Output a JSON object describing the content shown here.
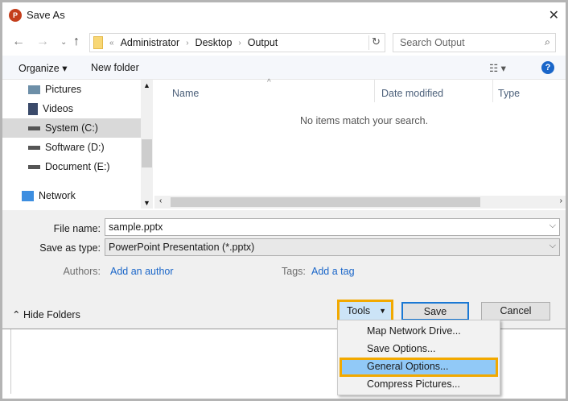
{
  "window": {
    "title": "Save As",
    "app_icon": "P"
  },
  "nav": {
    "path": [
      "Administrator",
      "Desktop",
      "Output"
    ],
    "overflow": "«",
    "search_placeholder": "Search Output"
  },
  "toolbar": {
    "organize": "Organize ▾",
    "new_folder": "New folder",
    "help": "?"
  },
  "sidebar": {
    "items": [
      {
        "label": "Pictures"
      },
      {
        "label": "Videos"
      },
      {
        "label": "System (C:)",
        "selected": true
      },
      {
        "label": "Software (D:)"
      },
      {
        "label": "Document (E:)"
      },
      {
        "label": "Network"
      }
    ]
  },
  "content": {
    "columns": [
      "Name",
      "Date modified",
      "Type"
    ],
    "empty_message": "No items match your search."
  },
  "form": {
    "file_name_label": "File name:",
    "file_name": "sample.pptx",
    "save_type_label": "Save as type:",
    "save_type": "PowerPoint Presentation (*.pptx)",
    "authors_label": "Authors:",
    "authors_link": "Add an author",
    "tags_label": "Tags:",
    "tags_link": "Add a tag"
  },
  "footer": {
    "hide_folders": "Hide Folders",
    "tools": "Tools",
    "save": "Save",
    "cancel": "Cancel"
  },
  "tools_menu": {
    "items": [
      "Map Network Drive...",
      "Save Options...",
      "General Options...",
      "Compress Pictures..."
    ],
    "highlighted": 2
  },
  "colors": {
    "accent": "#1a66c9",
    "highlight_border": "#f2a900",
    "menu_highlight": "#91c9f7"
  }
}
